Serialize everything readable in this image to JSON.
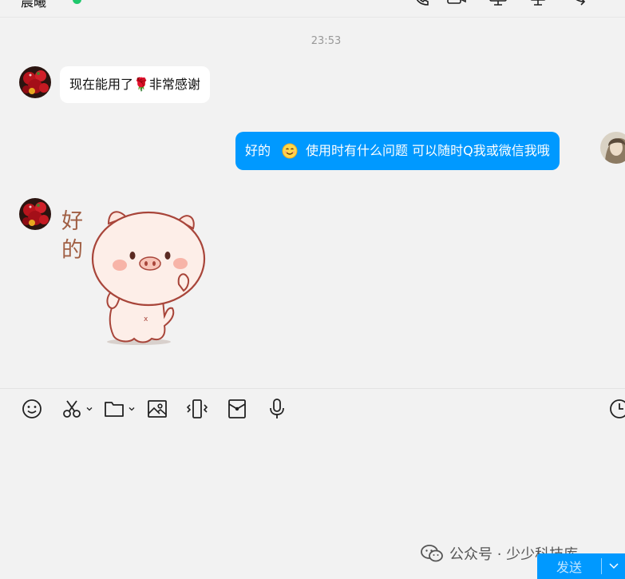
{
  "header": {
    "title": "晨曦",
    "online_status": "online"
  },
  "messages": {
    "timestamp": "23:53",
    "msg1_text": "现在能用了🌹非常感谢",
    "msg2_part1": "好的",
    "msg2_part2": "使用时有什么问题  可以随时Q我或微信我哦",
    "sticker_caption_line1": "好",
    "sticker_caption_line2": "的"
  },
  "toolbar": {
    "icons": [
      "emoji-icon",
      "scissors-icon",
      "folder-icon",
      "image-icon",
      "shake-icon",
      "red-packet-icon",
      "microphone-icon",
      "history-clock-icon"
    ]
  },
  "input": {
    "value": ""
  },
  "watermark": {
    "text": "公众号 · 少少科技库"
  },
  "send": {
    "label": "发送"
  },
  "colors": {
    "accent": "#0099ff",
    "background": "#f2f2f2",
    "bubble_in": "#ffffff",
    "online": "#1fc86c"
  }
}
